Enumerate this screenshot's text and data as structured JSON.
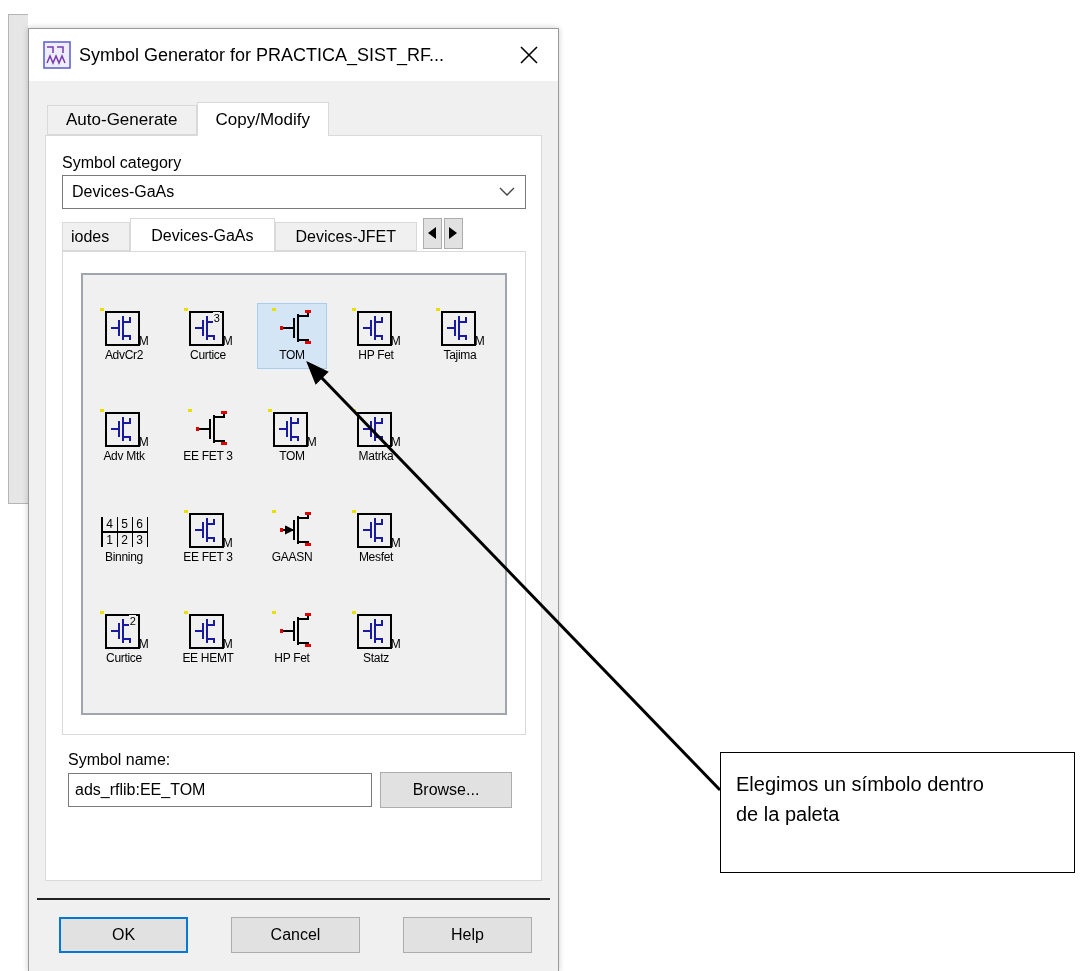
{
  "window": {
    "title": "Symbol Generator for PRACTICA_SIST_RF..."
  },
  "tabs": [
    {
      "label": "Auto-Generate",
      "selected": false
    },
    {
      "label": "Copy/Modify",
      "selected": true
    }
  ],
  "category": {
    "label": "Symbol category",
    "value": "Devices-GaAs"
  },
  "palette_tabs": [
    {
      "label": "iodes",
      "selected": false
    },
    {
      "label": "Devices-GaAs",
      "selected": true
    },
    {
      "label": "Devices-JFET",
      "selected": false
    }
  ],
  "palette_rows": [
    [
      {
        "label": "AdvCr2",
        "kind": "boxed",
        "suffix": "M",
        "selected": false
      },
      {
        "label": "Curtice",
        "kind": "boxed",
        "digit": "3",
        "suffix": "M",
        "selected": false
      },
      {
        "label": "TOM",
        "kind": "bare",
        "selected": true
      },
      {
        "label": "HP Fet",
        "kind": "boxed",
        "suffix": "M",
        "selected": false
      },
      {
        "label": "Tajima",
        "kind": "boxed",
        "suffix": "M",
        "selected": false
      }
    ],
    [
      {
        "label": "Adv Mtk",
        "kind": "boxed",
        "suffix": "M",
        "selected": false
      },
      {
        "label": "EE FET 3",
        "kind": "bare",
        "selected": false
      },
      {
        "label": "TOM",
        "kind": "boxed",
        "suffix": "M",
        "selected": false
      },
      {
        "label": "Matrka",
        "kind": "boxed",
        "suffix": "M",
        "selected": false
      }
    ],
    [
      {
        "label": "Binning",
        "kind": "binning",
        "grid": [
          "4",
          "5",
          "6",
          "1",
          "2",
          "3"
        ],
        "selected": false
      },
      {
        "label": "EE FET 3",
        "kind": "boxed",
        "suffix": "M",
        "selected": false
      },
      {
        "label": "GAASN",
        "kind": "arrow",
        "selected": false
      },
      {
        "label": "Mesfet",
        "kind": "boxed",
        "suffix": "M",
        "selected": false
      }
    ],
    [
      {
        "label": "Curtice",
        "kind": "boxed",
        "digit": "2",
        "suffix": "M",
        "selected": false
      },
      {
        "label": "EE HEMT",
        "kind": "boxed",
        "suffix": "M",
        "selected": false
      },
      {
        "label": "HP Fet",
        "kind": "bare",
        "selected": false
      },
      {
        "label": "Statz",
        "kind": "boxed",
        "suffix": "M",
        "selected": false
      }
    ]
  ],
  "symbol_name": {
    "label": "Symbol name:",
    "value": "ads_rflib:EE_TOM",
    "browse": "Browse..."
  },
  "buttons": [
    {
      "label": "OK",
      "focused": true
    },
    {
      "label": "Cancel",
      "focused": false
    },
    {
      "label": "Help",
      "focused": false
    }
  ],
  "callout": {
    "text": "Elegimos un símbolo dentro de la paleta"
  }
}
